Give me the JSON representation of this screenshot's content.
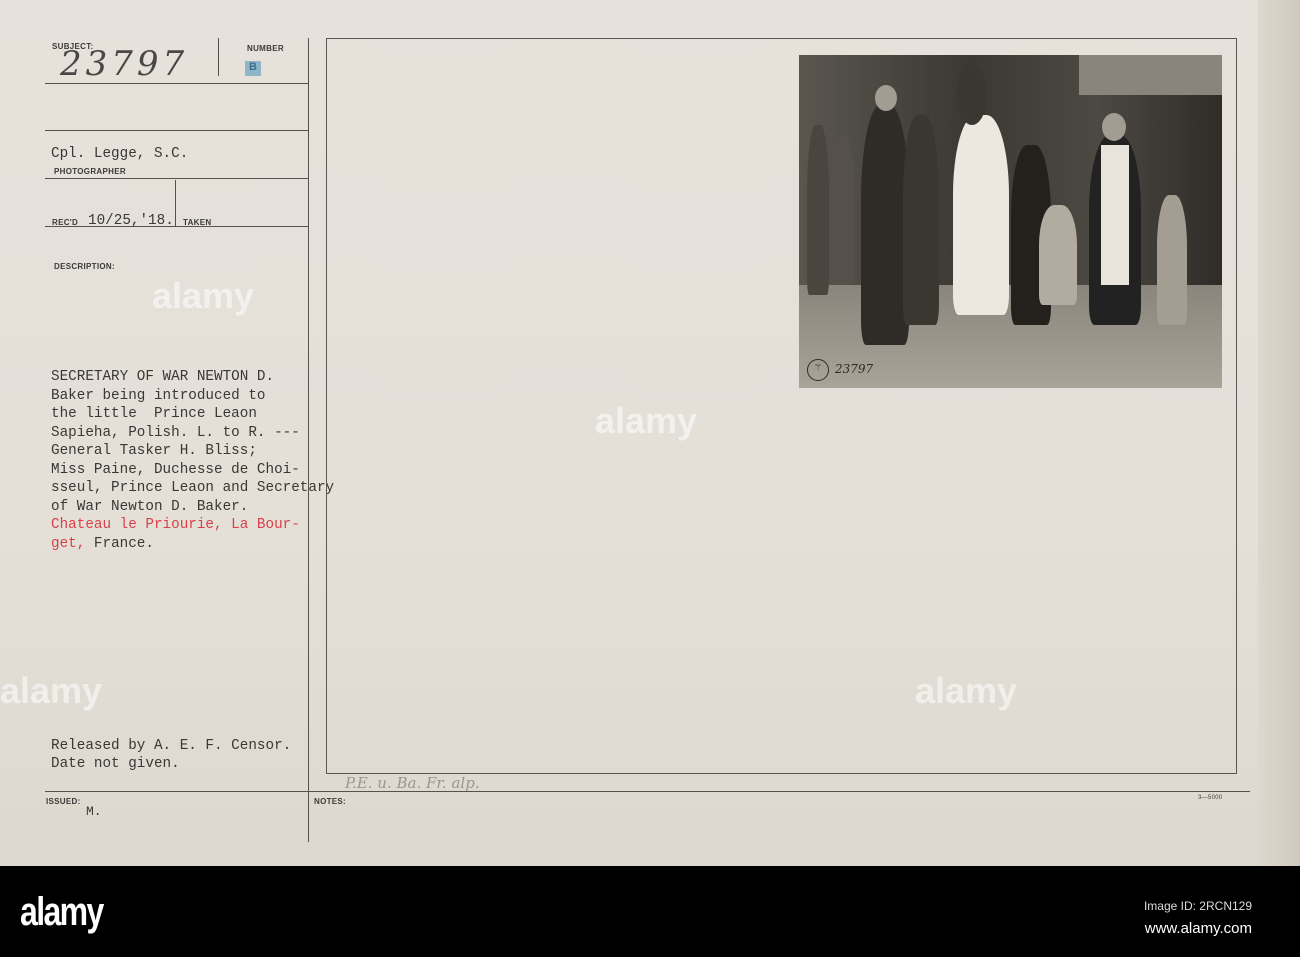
{
  "card": {
    "subject_label": "SUBJECT:",
    "subject_value": "23797",
    "number_label": "NUMBER",
    "number_stamp": "B",
    "photographer_value": "Cpl. Legge, S.C.",
    "photographer_label": "PHOTOGRAPHER",
    "recd_label": "REC'D",
    "recd_value": "10/25,'18.",
    "taken_label": "TAKEN",
    "description_label": "DESCRIPTION:",
    "description_lines": [
      "SECRETARY OF WAR NEWTON D.",
      "Baker being introduced to",
      "the little  Prince Leaon",
      "Sapieha, Polish. L. to R. ---",
      "General Tasker H. Bliss;",
      "Miss Paine, Duchesse de Choi-",
      "sseul, Prince Leaon and Secretary",
      "of War Newton D. Baker."
    ],
    "location_lines": [
      "Chateau le Priourie, La Bour-",
      "get,"
    ],
    "location_tail": " France.",
    "release_lines": [
      "Released by A. E. F. Censor.",
      "Date not given."
    ],
    "issued_label": "ISSUED:",
    "issued_value": "M.",
    "notes_label": "NOTES:",
    "handwritten_note": "P.E. u. Ba. Fr. alp.",
    "form_code": "3—5000",
    "photo_number": "23797",
    "photo_stamp": "⚚"
  },
  "colors": {
    "location_text": "#d8404a",
    "paper": "#e4e0d8",
    "bar": "#000000"
  },
  "watermark": {
    "logo": "alamy",
    "image_id": "Image ID: 2RCN129",
    "url": "www.alamy.com"
  }
}
